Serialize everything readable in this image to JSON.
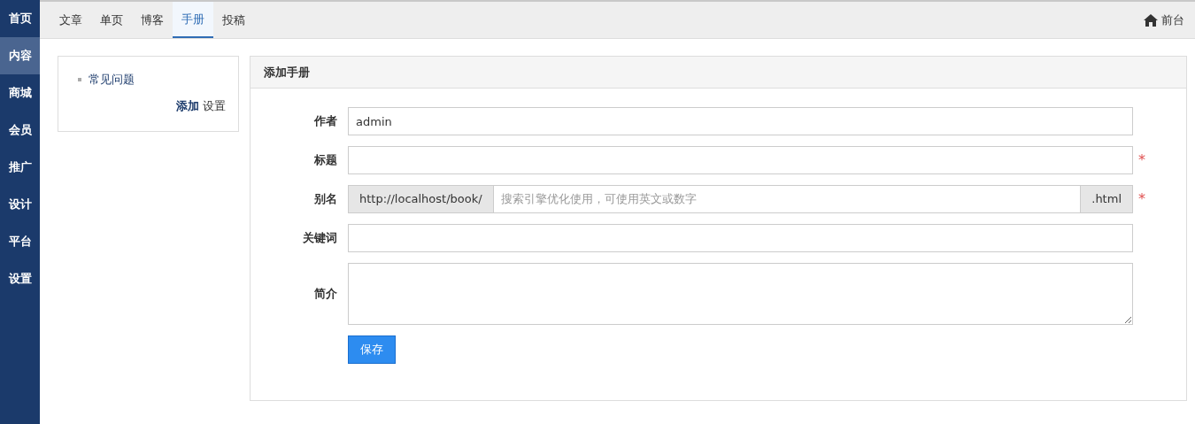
{
  "sidebar": {
    "items": [
      {
        "label": "首页",
        "selected": false
      },
      {
        "label": "内容",
        "selected": true
      },
      {
        "label": "商城",
        "selected": false
      },
      {
        "label": "会员",
        "selected": false
      },
      {
        "label": "推广",
        "selected": false
      },
      {
        "label": "设计",
        "selected": false
      },
      {
        "label": "平台",
        "selected": false
      },
      {
        "label": "设置",
        "selected": false
      }
    ]
  },
  "topnav": {
    "tabs": [
      {
        "label": "文章",
        "selected": false
      },
      {
        "label": "单页",
        "selected": false
      },
      {
        "label": "博客",
        "selected": false
      },
      {
        "label": "手册",
        "selected": true
      },
      {
        "label": "投稿",
        "selected": false
      }
    ],
    "frontend_link": "前台"
  },
  "category_panel": {
    "items": [
      "常见问题"
    ],
    "actions": [
      {
        "label": "添加",
        "selected": true
      },
      {
        "label": "设置",
        "selected": false
      }
    ]
  },
  "form": {
    "title": "添加手册",
    "fields": [
      {
        "kind": "text",
        "label": "作者",
        "value": "admin",
        "required": false
      },
      {
        "kind": "text",
        "label": "标题",
        "required": true
      },
      {
        "kind": "addon",
        "label": "别名",
        "prefix": "http://localhost/book/",
        "placeholder": "搜索引擎优化使用，可使用英文或数字",
        "suffix": ".html",
        "required": true
      },
      {
        "kind": "text",
        "label": "关键词",
        "required": false
      },
      {
        "kind": "textarea",
        "label": "简介",
        "required": false
      }
    ],
    "required_mark": "*",
    "submit": "保存"
  }
}
